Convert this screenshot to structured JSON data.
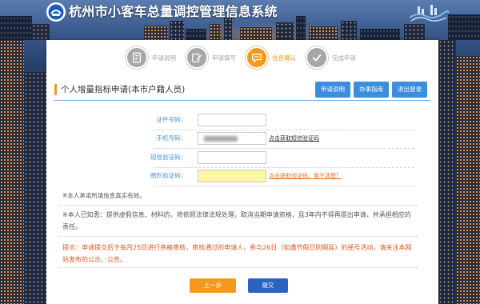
{
  "header": {
    "title": "杭州市小客车总量调控管理信息系统",
    "logo_icon": "city-emblem-icon",
    "partner_logo_icon": "skyline-logo-icon"
  },
  "steps": [
    {
      "label": "申请说明",
      "icon": "document-icon",
      "active": false
    },
    {
      "label": "申请填写",
      "icon": "edit-icon",
      "active": false
    },
    {
      "label": "信息确认",
      "icon": "chat-icon",
      "active": true
    },
    {
      "label": "完成申请",
      "icon": "check-icon",
      "active": false
    }
  ],
  "section": {
    "title": "个人增量指标申请(本市户籍人员)",
    "buttons": {
      "instructions": "申请说明",
      "guide": "办事指南",
      "logout": "退出登录"
    }
  },
  "form": {
    "id_number": {
      "label": "证件号码：",
      "value": ""
    },
    "phone": {
      "label": "手机号码：",
      "link": "点击获取短信验证码"
    },
    "sms_code": {
      "label": "短信验证码：",
      "value": ""
    },
    "captcha": {
      "label": "图形验证码：",
      "value": "",
      "link": "点击获取验证码，看不清楚？"
    }
  },
  "notes": {
    "commitment": "※本人承诺所填信息真实有效。",
    "acknowledgement": "※本人已知悉：提供虚假信息、材料的，将依照法律法规处理，取消当期申请资格，且3年内不得再提出申请，并承担相应的责任。",
    "tip": "提示：申请提交后于每月25日进行资格审核，审核通过的申请人，参与26日（如遇节假日则顺延）的摇号活动，请关注本网站发布的公示、公告。"
  },
  "actions": {
    "prev": "上一步",
    "submit": "提交"
  },
  "colors": {
    "accent": "#f39a1e",
    "primary": "#3b8de0",
    "label": "#4a8fd8",
    "tip": "#e0541f",
    "captcha": "#fff6a8",
    "submit": "#2a62c0"
  }
}
